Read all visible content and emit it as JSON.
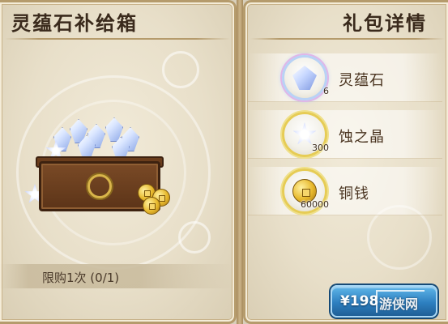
{
  "left_panel": {
    "title": "灵蕴石补给箱",
    "purchase_limit": "限购1次 (0/1)"
  },
  "right_panel": {
    "title": "礼包详情",
    "rewards": [
      {
        "name": "灵蕴石",
        "quantity": "6",
        "icon": "spirit-stone-icon"
      },
      {
        "name": "蚀之晶",
        "quantity": "300",
        "icon": "erosion-crystal-icon"
      },
      {
        "name": "铜钱",
        "quantity": "60000",
        "icon": "copper-coin-icon"
      }
    ]
  },
  "buy_button": {
    "price_label": "¥198"
  },
  "watermark": "游侠网",
  "colors": {
    "panel_bg": "#ebe2cd",
    "panel_border": "#b59b6c",
    "title_text": "#3a2a1c",
    "button_blue": "#2d7fc0",
    "coin_gold": "#e7b82c"
  }
}
